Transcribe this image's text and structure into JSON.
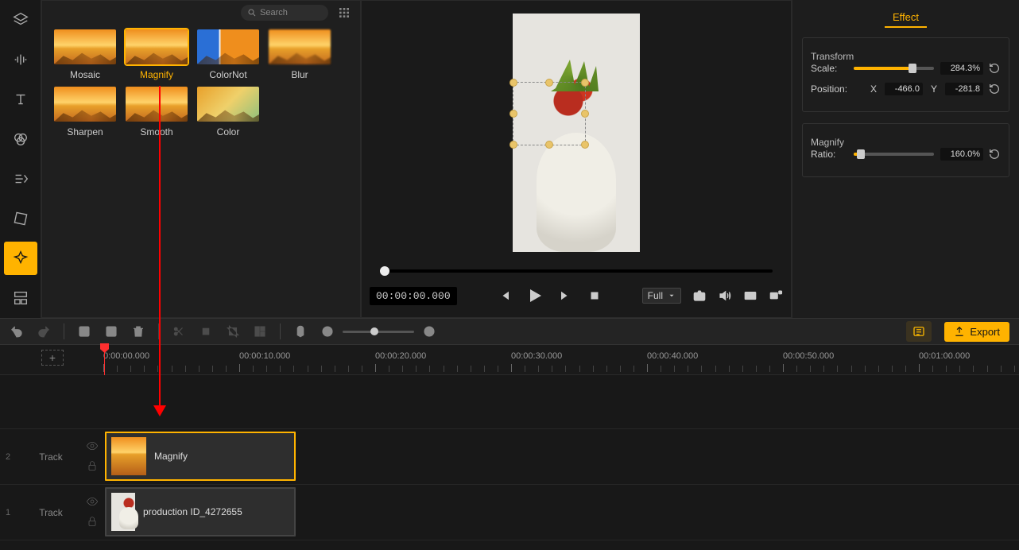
{
  "sidebar": {
    "items": [
      {
        "name": "layers-icon"
      },
      {
        "name": "audio-icon"
      },
      {
        "name": "text-icon"
      },
      {
        "name": "filters-icon"
      },
      {
        "name": "transitions-icon"
      },
      {
        "name": "transform-icon"
      },
      {
        "name": "effects-icon",
        "active": true
      },
      {
        "name": "templates-icon"
      }
    ]
  },
  "effects": {
    "search_placeholder": "Search",
    "items": [
      {
        "label": "Mosaic"
      },
      {
        "label": "Magnify",
        "selected": true
      },
      {
        "label": "ColorNot"
      },
      {
        "label": "Blur"
      },
      {
        "label": "Sharpen"
      },
      {
        "label": "Smooth"
      },
      {
        "label": "Color"
      }
    ]
  },
  "preview": {
    "timecode": "00:00:00.000",
    "scale_label": "Full"
  },
  "properties": {
    "tab": "Effect",
    "transform": {
      "title": "Transform",
      "scale_label": "Scale:",
      "scale_value": "284.3%",
      "position_label": "Position:",
      "x_label": "X",
      "x_value": "-466.0",
      "y_label": "Y",
      "y_value": "-281.8"
    },
    "magnify": {
      "title": "Magnify",
      "ratio_label": "Ratio:",
      "ratio_value": "160.0%"
    }
  },
  "toolbar": {
    "export_label": "Export"
  },
  "ruler": {
    "majors": [
      "0:00:00.000",
      "00:00:10.000",
      "00:00:20.000",
      "00:00:30.000",
      "00:00:40.000",
      "00:00:50.000",
      "00:01:00.000"
    ]
  },
  "tracks": {
    "label": "Track",
    "2": {
      "num": "2",
      "clip_label": "Magnify"
    },
    "1": {
      "num": "1",
      "clip_label": "production ID_4272655"
    }
  }
}
